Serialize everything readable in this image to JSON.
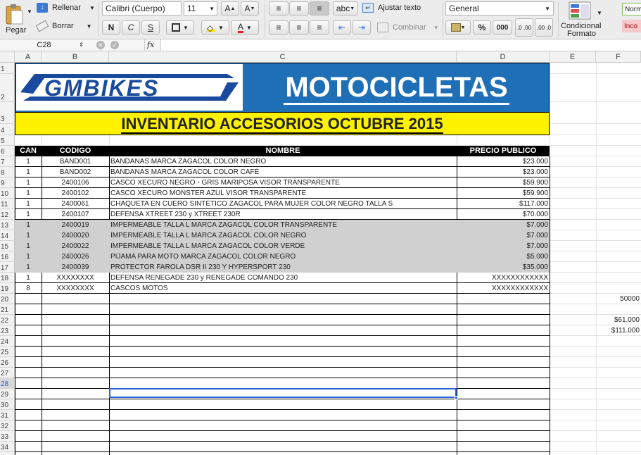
{
  "ribbon": {
    "paste": "Pegar",
    "fill": "Rellenar",
    "clear": "Borrar",
    "font_name": "Calibri (Cuerpo)",
    "font_size": "11",
    "grow_font": "A",
    "shrink_font": "A",
    "bold": "N",
    "italic": "C",
    "underline": "S",
    "font_color": "A",
    "wrap_text": "Ajustar texto",
    "merge": "Combinar",
    "number_format": "General",
    "percent": "%",
    "thousands": "000",
    "inc_decimal": ",0 ,00",
    "dec_decimal": ",00 ,0",
    "conditional": "Condicional",
    "format": "Formato",
    "style_normal": "Norm",
    "style_bad": "Inco",
    "abc": "abc"
  },
  "formula_bar": {
    "cell_ref": "C28",
    "fx": "fx",
    "value": ""
  },
  "columns": [
    "A",
    "B",
    "C",
    "D",
    "E",
    "F"
  ],
  "rows": [
    "1",
    "2",
    "3",
    "4",
    "5",
    "6",
    "7",
    "8",
    "9",
    "10",
    "11",
    "12",
    "13",
    "14",
    "15",
    "16",
    "17",
    "18",
    "19",
    "20",
    "21",
    "22",
    "23",
    "24",
    "25",
    "26",
    "27",
    "28",
    "29",
    "30",
    "31",
    "32",
    "33",
    "34"
  ],
  "sheet": {
    "logo": "GMBIKES",
    "title": "MOTOCICLETAS",
    "subtitle": "INVENTARIO ACCESORIOS OCTUBRE 2015",
    "headers": {
      "can": "CAN",
      "codigo": "CODIGO",
      "nombre": "NOMBRE",
      "precio": "PRECIO PUBLICO"
    },
    "items": [
      {
        "can": "1",
        "codigo": "BAND001",
        "nombre": "BANDANAS MARCA ZAGACOL COLOR NEGRO",
        "precio": "$23.000"
      },
      {
        "can": "1",
        "codigo": "BAND002",
        "nombre": "BANDANAS MARCA ZAGACOL COLOR CAFÉ",
        "precio": "$23.000"
      },
      {
        "can": "1",
        "codigo": "2400106",
        "nombre": "CASCO XECURO NEGRO - GRIS MARIPOSA VISOR TRANSPARENTE",
        "precio": "$59.900"
      },
      {
        "can": "1",
        "codigo": "2400102",
        "nombre": "CASCO XECURO MONSTER AZUL VISOR TRANSPARENTE",
        "precio": "$59.900"
      },
      {
        "can": "1",
        "codigo": "2400061",
        "nombre": "CHAQUETA EN CUERO SINTETICO ZAGACOL PARA MUJER COLOR NEGRO TALLA S",
        "precio": "$117.000"
      },
      {
        "can": "1",
        "codigo": "2400107",
        "nombre": "DEFENSA XTREET 230 y XTREET 230R",
        "precio": "$70.000"
      },
      {
        "can": "1",
        "codigo": "2400019",
        "nombre": "IMPERMEABLE TALLA L MARCA ZAGACOL COLOR TRANSPARENTE",
        "precio": "$7.000"
      },
      {
        "can": "1",
        "codigo": "2400020",
        "nombre": "IMPERMEABLE TALLA L MARCA ZAGACOL COLOR NEGRO",
        "precio": "$7.000"
      },
      {
        "can": "1",
        "codigo": "2400022",
        "nombre": "IMPERMEABLE TALLA L MARCA ZAGACOL COLOR VERDE",
        "precio": "$7.000"
      },
      {
        "can": "1",
        "codigo": "2400026",
        "nombre": "PIJAMA PARA MOTO  MARCA ZAGACOL COLOR NEGRO",
        "precio": "$5.000"
      },
      {
        "can": "1",
        "codigo": "2400039",
        "nombre": "PROTECTOR FAROLA DSR II 230 Y HYPERSPORT 230",
        "precio": "$35.000"
      },
      {
        "can": "1",
        "codigo": "XXXXXXXX",
        "nombre": "DEFENSA RENEGADE 230 y RENEGADE COMANDO 230",
        "precio": "XXXXXXXXXXXX"
      },
      {
        "can": "8",
        "codigo": "XXXXXXXX",
        "nombre": "CASCOS MOTOS",
        "precio": "XXXXXXXXXXXX"
      }
    ],
    "side_values": [
      {
        "row": "20",
        "value": "50000"
      },
      {
        "row": "22",
        "value": "$61.000"
      },
      {
        "row": "23",
        "value": "$111.000"
      }
    ]
  },
  "colors": {
    "title_bg": "#1f6fb6",
    "subtitle_bg": "#fff200",
    "header_bg": "#000000",
    "gray_row": "#d0d0d0"
  }
}
